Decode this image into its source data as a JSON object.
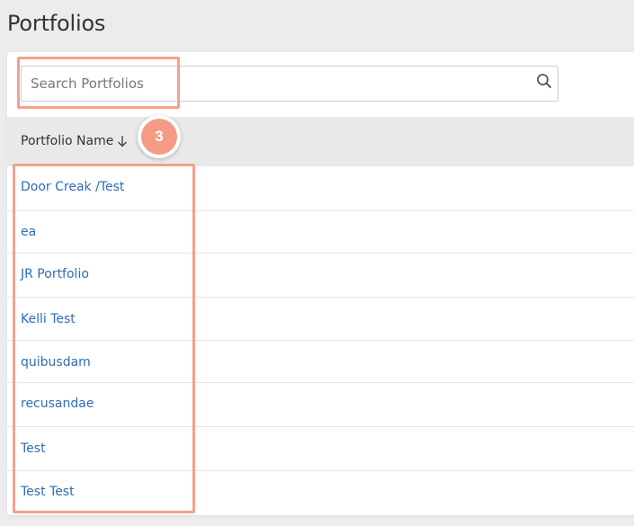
{
  "page": {
    "title": "Portfolios"
  },
  "search": {
    "placeholder": "Search Portfolios",
    "value": ""
  },
  "table": {
    "column_header": "Portfolio Name",
    "sort": "descending-arrow",
    "rows": [
      "Door Creak /Test",
      "ea",
      "JR Portfolio",
      "Kelli Test",
      "quibusdam",
      "recusandae",
      "Test",
      "Test Test"
    ]
  },
  "annotation": {
    "step_number": "3",
    "highlight_color": "#f5a08c",
    "badge_color": "#f59a85"
  },
  "colors": {
    "link": "#2f6cb5",
    "header_bg": "#e9e9e9",
    "page_bg": "#ececec"
  }
}
